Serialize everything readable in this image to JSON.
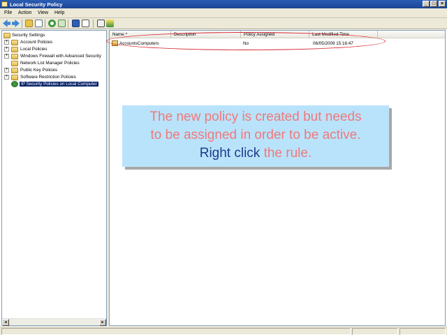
{
  "window": {
    "title": "Local Security Policy",
    "buttons": {
      "minimize": "_",
      "maximize": "□",
      "close": "×"
    }
  },
  "menu": [
    "File",
    "Action",
    "View",
    "Help"
  ],
  "toolbar": {
    "icons": [
      "back-arrow-icon",
      "forward-arrow-icon",
      "up-folder-icon",
      "show-hide-tree-icon",
      "refresh-icon",
      "export-list-icon",
      "help-icon",
      "console-icon",
      "policy-icon",
      "assign-icon"
    ]
  },
  "tree": {
    "root": {
      "label": "Security Settings"
    },
    "items": [
      {
        "label": "Account Policies",
        "expandable": true
      },
      {
        "label": "Local Policies",
        "expandable": true
      },
      {
        "label": "Windows Firewall with Advanced Security",
        "expandable": true
      },
      {
        "label": "Network List Manager Policies",
        "expandable": false
      },
      {
        "label": "Public Key Policies",
        "expandable": true
      },
      {
        "label": "Software Restriction Policies",
        "expandable": true
      },
      {
        "label": "IP Security Policies on Local Computer",
        "expandable": false,
        "selected": true
      }
    ]
  },
  "list": {
    "columns": [
      "Name  ^",
      "Description",
      "Policy Assigned",
      "Last Modified Time"
    ],
    "rows": [
      {
        "name": "AccountsComputers",
        "description": "",
        "assigned": "No",
        "modified": "06/05/2009 15:16:47"
      }
    ]
  },
  "callout": {
    "line1": "The new policy is created but needs",
    "line2": "to be assigned in order to be active.",
    "line3_emph": "Right click",
    "line3_rest": " the rule."
  },
  "colors": {
    "titlebar": "#1c4596",
    "selection": "#0a246a",
    "callout_bg": "#b9e3fb",
    "callout_text": "#f0797a",
    "callout_emph": "#1f3a8a",
    "highlight_ellipse": "#d8232a"
  }
}
